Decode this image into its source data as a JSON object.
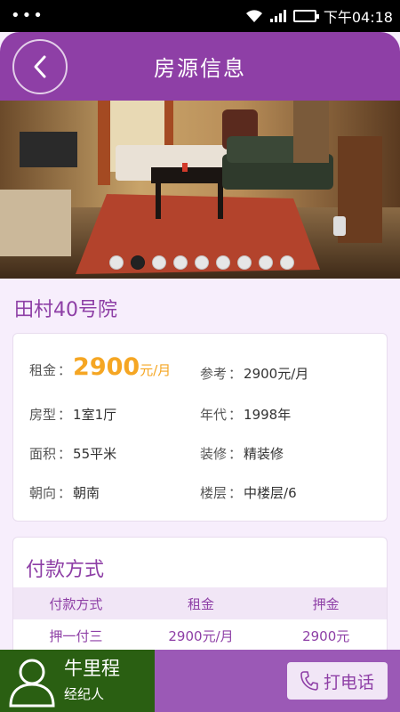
{
  "status_bar": {
    "left": "•••",
    "time": "下午04:18"
  },
  "header": {
    "title": "房源信息"
  },
  "gallery": {
    "dot_count": 9,
    "active_index": 1
  },
  "property": {
    "name": "田村40号院"
  },
  "info": {
    "rent_label": "租金",
    "rent_value": "2900",
    "rent_unit": "元/月",
    "ref_label": "参考",
    "ref_value": "2900元/月",
    "layout_label": "房型",
    "layout_value": "1室1厅",
    "year_label": "年代",
    "year_value": "1998年",
    "area_label": "面积",
    "area_value": "55平米",
    "deco_label": "装修",
    "deco_value": "精装修",
    "orient_label": "朝向",
    "orient_value": "朝南",
    "floor_label": "楼层",
    "floor_value": "中楼层/6",
    "separator": "："
  },
  "payment": {
    "title": "付款方式",
    "headers": [
      "付款方式",
      "租金",
      "押金"
    ],
    "rows": [
      [
        "押一付三",
        "2900元/月",
        "2900元"
      ]
    ]
  },
  "agent": {
    "name": "牛里程",
    "role": "经纪人",
    "call_label": "打电话"
  }
}
